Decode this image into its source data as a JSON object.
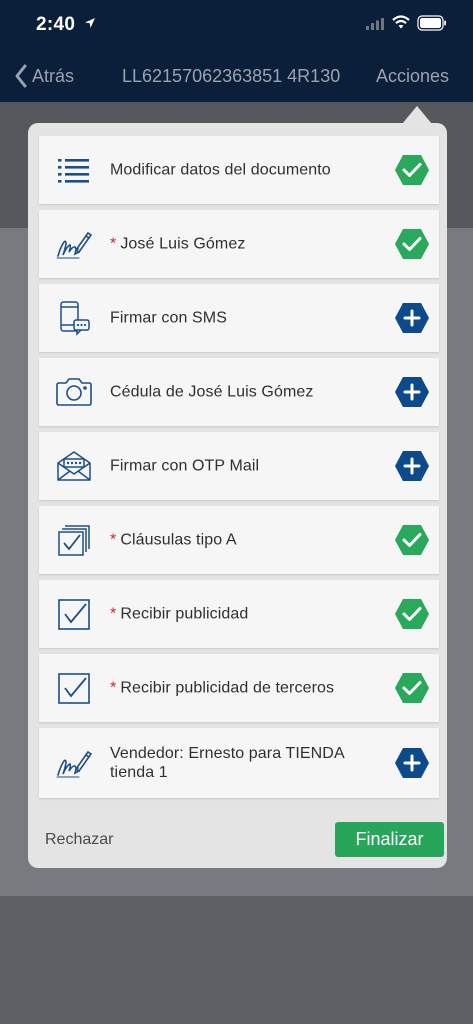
{
  "status_bar": {
    "time": "2:40"
  },
  "nav": {
    "back_label": "Atrás",
    "title": "LL62157062363851 4R130",
    "actions_label": "Acciones"
  },
  "items": [
    {
      "label": "Modificar datos del documento",
      "required": false,
      "status": "done",
      "icon": "list-icon"
    },
    {
      "label": "José Luis Gómez",
      "required": true,
      "status": "done",
      "icon": "signature-icon"
    },
    {
      "label": "Firmar con SMS",
      "required": false,
      "status": "add",
      "icon": "phone-sms-icon"
    },
    {
      "label": "Cédula de José Luis Gómez",
      "required": false,
      "status": "add",
      "icon": "camera-icon"
    },
    {
      "label": "Firmar con OTP Mail",
      "required": false,
      "status": "add",
      "icon": "mail-icon"
    },
    {
      "label": "Cláusulas tipo A",
      "required": true,
      "status": "done",
      "icon": "stacked-checkbox-icon"
    },
    {
      "label": "Recibir publicidad",
      "required": true,
      "status": "done",
      "icon": "checkbox-icon"
    },
    {
      "label": "Recibir publicidad de terceros",
      "required": true,
      "status": "done",
      "icon": "checkbox-icon"
    },
    {
      "label": "Vendedor: Ernesto para TIENDA tienda 1",
      "required": false,
      "status": "add",
      "icon": "signature-icon"
    }
  ],
  "footer": {
    "reject_label": "Rechazar",
    "finalize_label": "Finalizar"
  },
  "colors": {
    "done": "#2aa85c",
    "add": "#0c4a8c",
    "icon": "#1d4f86",
    "header": "#0b1f3a",
    "required": "#d0202a"
  }
}
